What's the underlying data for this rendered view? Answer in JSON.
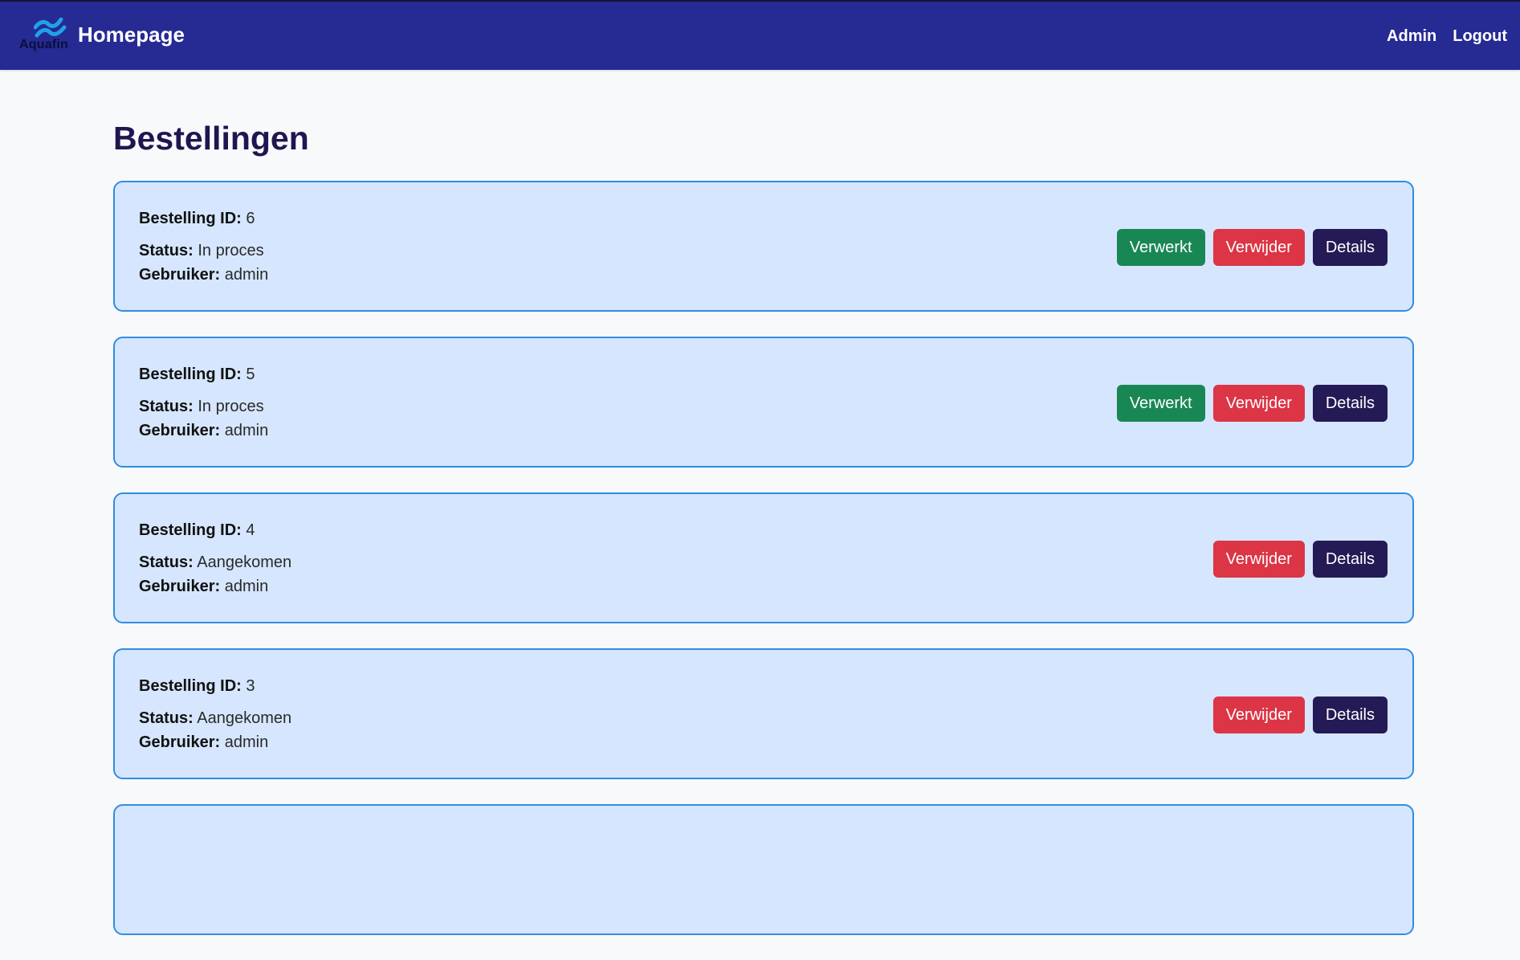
{
  "navbar": {
    "logo_text": "Aquafin",
    "title": "Homepage",
    "links": [
      "Admin",
      "Logout"
    ],
    "bg_color": "#262a93"
  },
  "page": {
    "title": "Bestellingen"
  },
  "labels": {
    "id": "Bestelling ID:",
    "status": "Status:",
    "user": "Gebruiker:"
  },
  "buttons": {
    "processed": "Verwerkt",
    "delete": "Verwijder",
    "details": "Details"
  },
  "orders": [
    {
      "id": "6",
      "status": "In proces",
      "user": "admin",
      "show_processed": true
    },
    {
      "id": "5",
      "status": "In proces",
      "user": "admin",
      "show_processed": true
    },
    {
      "id": "4",
      "status": "Aangekomen",
      "user": "admin",
      "show_processed": false
    },
    {
      "id": "3",
      "status": "Aangekomen",
      "user": "admin",
      "show_processed": false
    },
    {
      "id": "",
      "status": "",
      "user": "",
      "show_processed": false
    }
  ],
  "colors": {
    "card_bg": "#d6e6fe",
    "card_border": "#2f8ee0",
    "processed": "#198754",
    "delete": "#dc3545",
    "details": "#241a55",
    "title": "#1f1650"
  }
}
